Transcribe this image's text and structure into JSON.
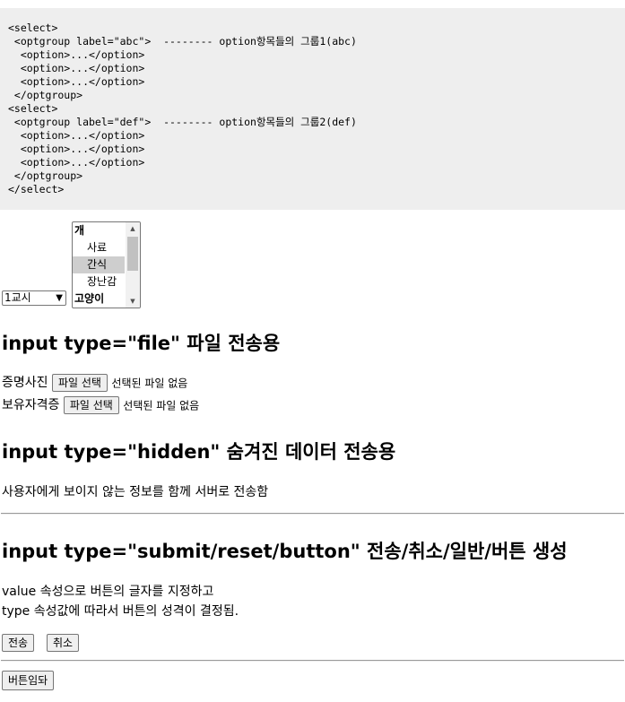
{
  "code_block": {
    "lines": [
      "<select>",
      " <optgroup label=\"abc\">  -------- option항목들의 그룹1(abc)",
      "  <option>...</option>",
      "  <option>...</option>",
      "  <option>...</option>",
      " </optgroup>",
      "<select>",
      " <optgroup label=\"def\">  -------- option항목들의 그룹2(def)",
      "  <option>...</option>",
      "  <option>...</option>",
      "  <option>...</option>",
      " </optgroup>",
      "</select>"
    ]
  },
  "period_select": {
    "value": "1교시"
  },
  "listbox": {
    "rows": [
      {
        "label": "개",
        "type": "group"
      },
      {
        "label": "사료",
        "type": "option"
      },
      {
        "label": "간식",
        "type": "option",
        "selected": true
      },
      {
        "label": "장난감",
        "type": "option"
      },
      {
        "label": "고양이",
        "type": "group"
      }
    ]
  },
  "file_section": {
    "heading": "input type=\"file\" 파일 전송용",
    "rows": [
      {
        "label": "증명사진",
        "button": "파일 선택",
        "status": "선택된 파일 없음"
      },
      {
        "label": "보유자격증",
        "button": "파일 선택",
        "status": "선택된 파일 없음"
      }
    ]
  },
  "hidden_section": {
    "heading": "input type=\"hidden\" 숨겨진 데이터 전송용",
    "text": "사용자에게 보이지 않는 정보를 함께 서버로 전송함"
  },
  "button_section": {
    "heading": "input type=\"submit/reset/button\" 전송/취소/일반/버튼 생성",
    "line1": "value 속성으로 버튼의 글자를 지정하고",
    "line2": "type 속성값에 따라서 버튼의 성격이 결정됨.",
    "submit": "전송",
    "reset": "취소",
    "general": "버튼임돠"
  }
}
